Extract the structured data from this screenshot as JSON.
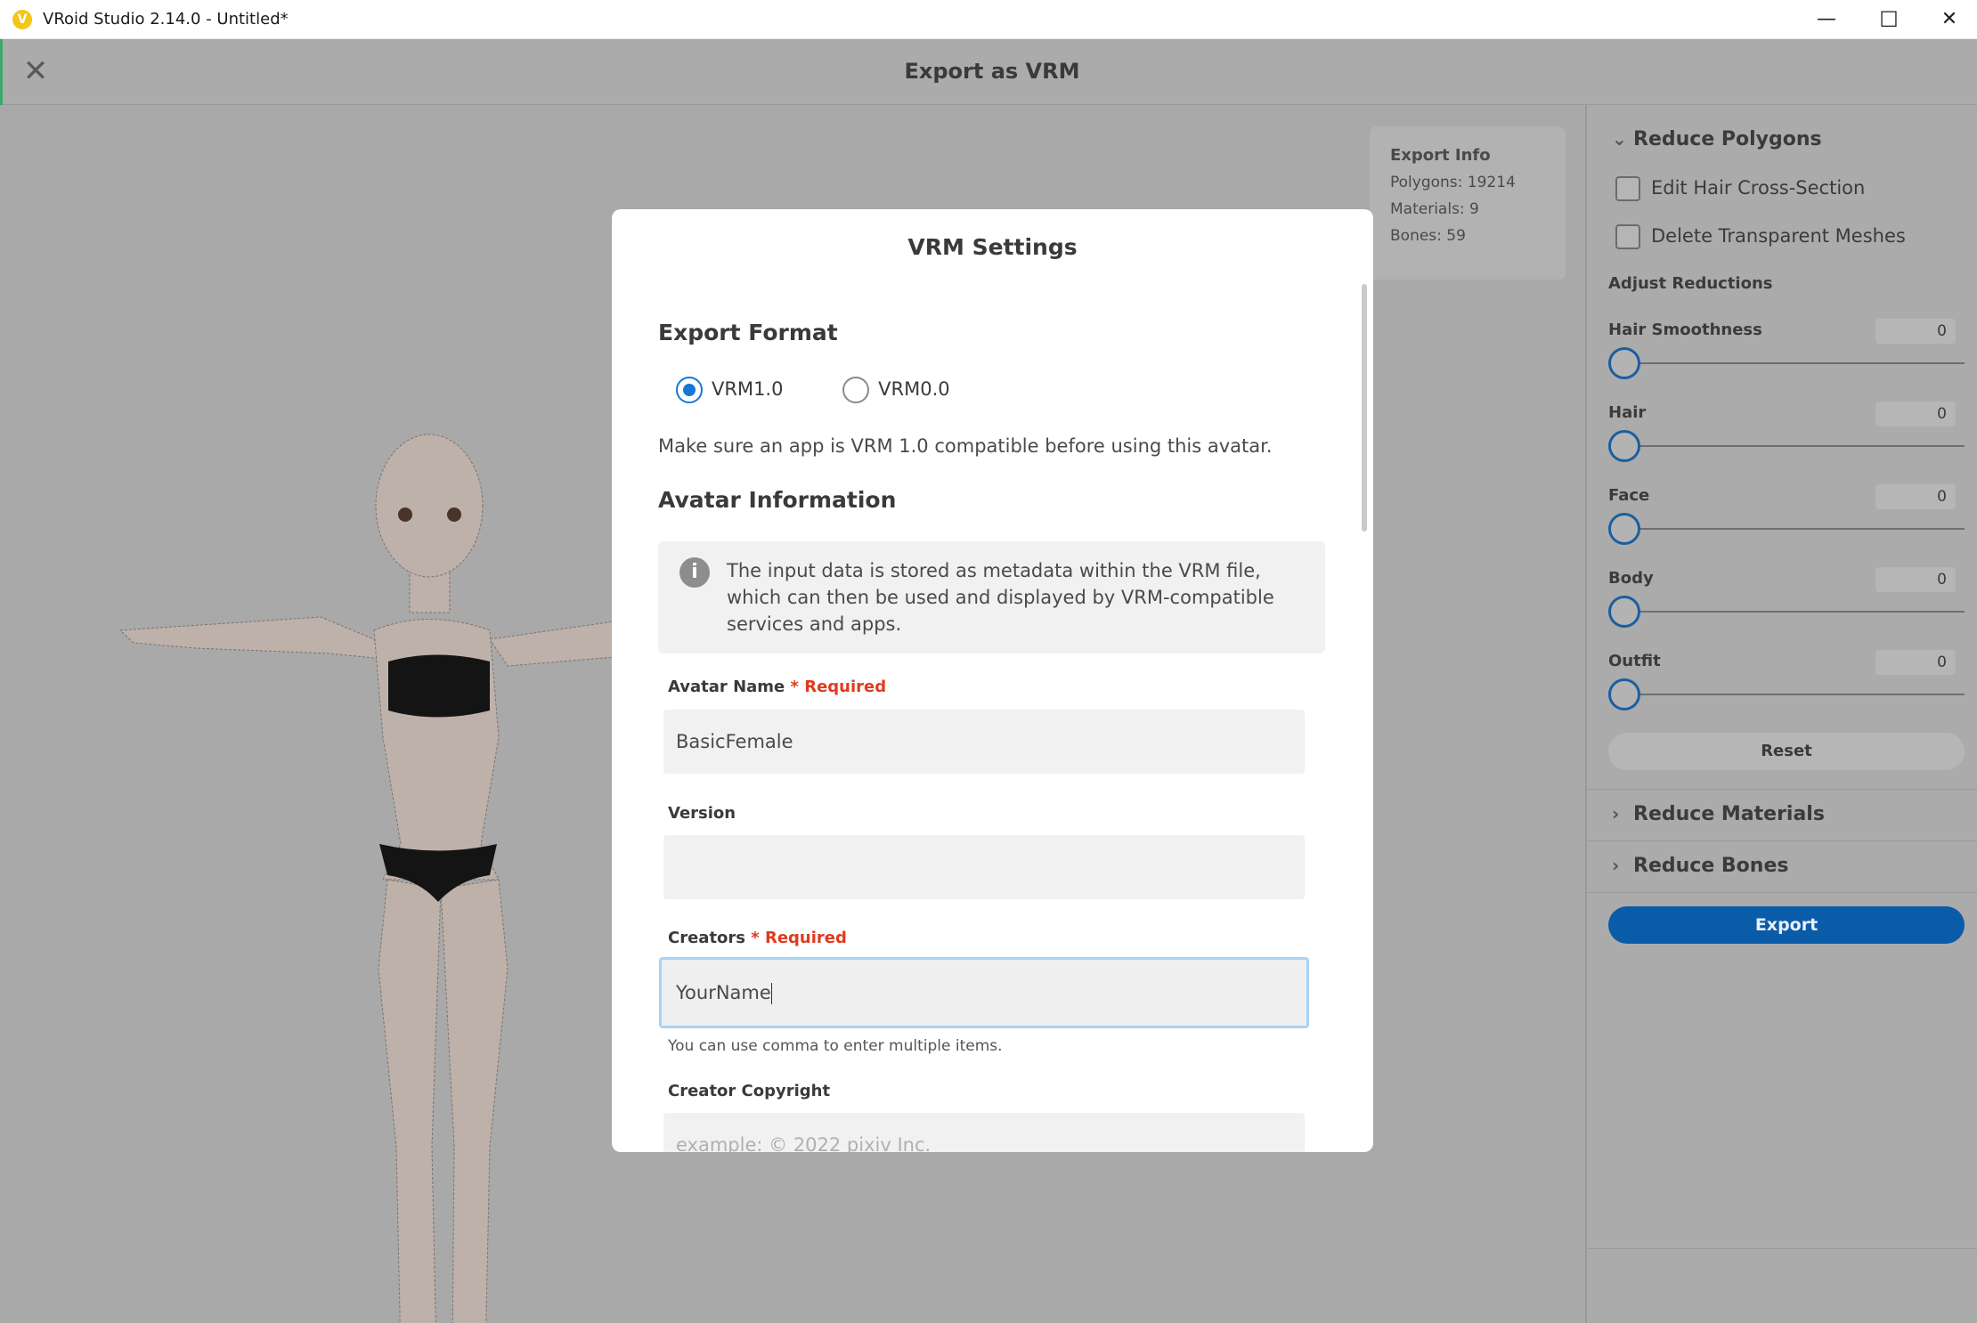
{
  "window": {
    "title": "VRoid Studio 2.14.0 - Untitled*",
    "app_icon": "V",
    "minimize": "—",
    "maximize": "☐",
    "close": "✕"
  },
  "header": {
    "close_icon": "✕",
    "title": "Export as VRM"
  },
  "export_info": {
    "heading": "Export Info",
    "polygons": "Polygons: 19214",
    "materials": "Materials: 9",
    "bones": "Bones: 59"
  },
  "panel": {
    "reduce_polygons": "Reduce Polygons",
    "edit_hair": "Edit Hair Cross-Section",
    "delete_transparent": "Delete Transparent Meshes",
    "adjust_reductions": "Adjust Reductions",
    "sliders": [
      {
        "label": "Hair Smoothness",
        "value": "0"
      },
      {
        "label": "Hair",
        "value": "0"
      },
      {
        "label": "Face",
        "value": "0"
      },
      {
        "label": "Body",
        "value": "0"
      },
      {
        "label": "Outfit",
        "value": "0"
      }
    ],
    "reset": "Reset",
    "reduce_materials": "Reduce Materials",
    "reduce_bones": "Reduce Bones",
    "export": "Export"
  },
  "modal": {
    "title": "VRM Settings",
    "export_format": "Export Format",
    "options": [
      "VRM1.0",
      "VRM0.0"
    ],
    "selected": "VRM1.0",
    "compat_note": "Make sure an app is VRM 1.0 compatible before using this avatar.",
    "avatar_info": "Avatar Information",
    "info_icon": "i",
    "info_text": "The input data is stored as metadata within the VRM file, which can then be used and displayed by VRM-compatible services and apps.",
    "required": "* Required",
    "avatar_name_label": "Avatar Name",
    "avatar_name_value": "BasicFemale",
    "version_label": "Version",
    "version_value": "",
    "creators_label": "Creators",
    "creators_value": "YourName",
    "creators_hint": "You can use comma to enter multiple items.",
    "copyright_label": "Creator Copyright",
    "copyright_placeholder": "example: ©      2022 pixiv Inc."
  },
  "colors": {
    "accent": "#1877d2",
    "export_button": "#0b5ca8",
    "required": "#e03a1f"
  }
}
